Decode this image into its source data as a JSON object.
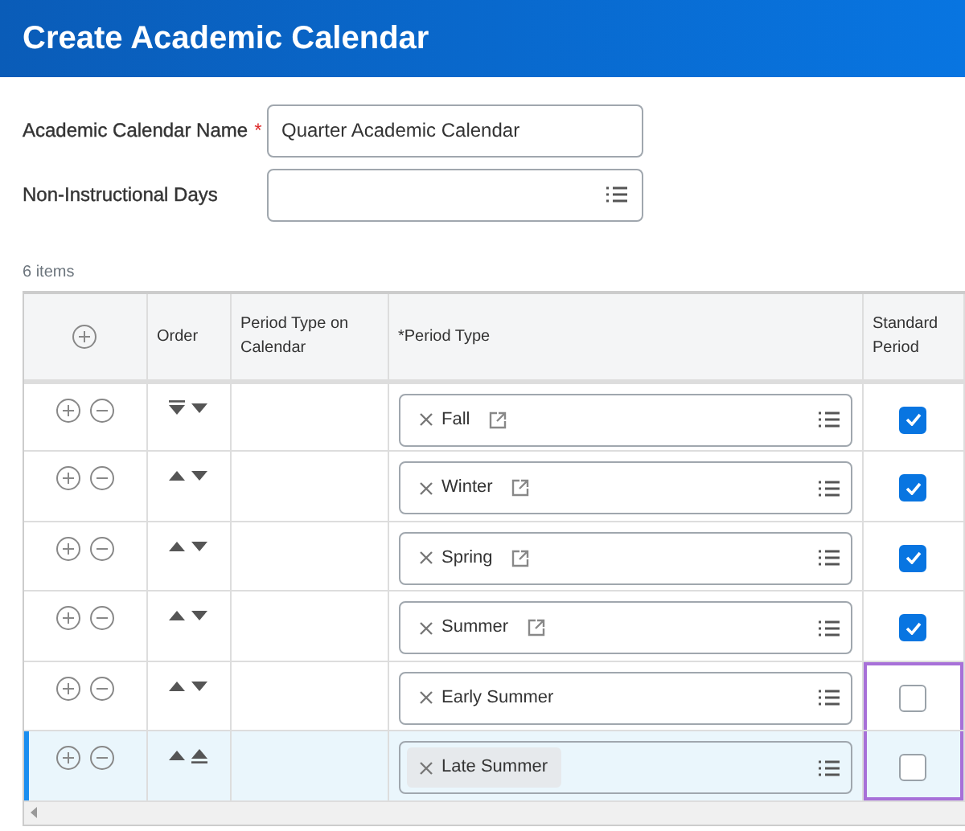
{
  "page_title": "Create Academic Calendar",
  "fields": [
    {
      "label": "Academic Calendar Name",
      "required_mark": "*",
      "value": "Quarter Academic Calendar",
      "kind": "text"
    },
    {
      "label": "Non-Instructional Days",
      "kind": "prompt"
    }
  ],
  "item_count": "6 items",
  "table": {
    "columns": [
      "Order",
      "Period Type on Calendar",
      "*Period Type",
      "Standard Period"
    ],
    "rows": [
      {
        "order_buttons": [
          {
            "kind": "bottom"
          },
          {
            "kind": "down"
          }
        ],
        "period_type": "Fall",
        "has_link": true,
        "tag_highlighted": false,
        "standard_period": true,
        "outlined": false,
        "selected": false
      },
      {
        "order_buttons": [
          {
            "kind": "up"
          },
          {
            "kind": "down"
          }
        ],
        "period_type": "Winter",
        "has_link": true,
        "tag_highlighted": false,
        "standard_period": true,
        "outlined": false,
        "selected": false
      },
      {
        "order_buttons": [
          {
            "kind": "up"
          },
          {
            "kind": "down"
          }
        ],
        "period_type": "Spring",
        "has_link": true,
        "tag_highlighted": false,
        "standard_period": true,
        "outlined": false,
        "selected": false
      },
      {
        "order_buttons": [
          {
            "kind": "up"
          },
          {
            "kind": "down"
          }
        ],
        "period_type": "Summer",
        "has_link": true,
        "tag_highlighted": false,
        "standard_period": true,
        "outlined": false,
        "selected": false
      },
      {
        "order_buttons": [
          {
            "kind": "up"
          },
          {
            "kind": "down"
          }
        ],
        "period_type": "Early Summer",
        "has_link": false,
        "tag_highlighted": false,
        "standard_period": false,
        "outlined": true,
        "selected": false
      },
      {
        "order_buttons": [
          {
            "kind": "up"
          },
          {
            "kind": "top"
          }
        ],
        "period_type": "Late Summer",
        "has_link": false,
        "tag_highlighted": true,
        "standard_period": false,
        "outlined": true,
        "selected": true
      }
    ]
  }
}
